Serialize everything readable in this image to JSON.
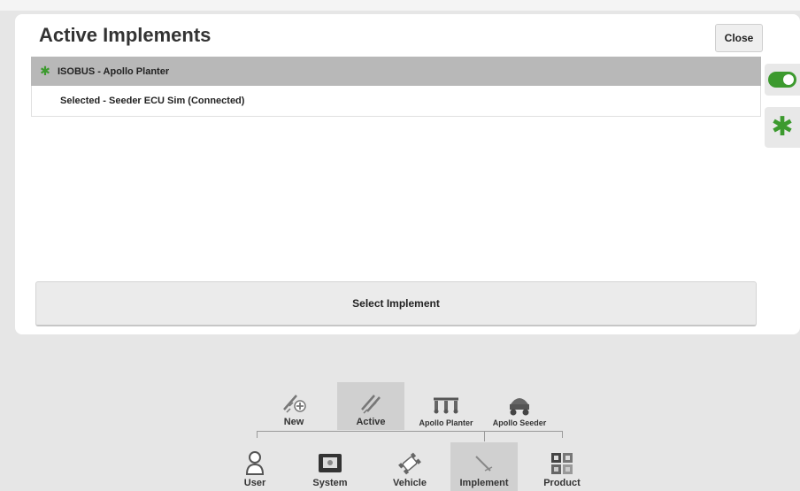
{
  "page": {
    "title": "Active Implements",
    "close_label": "Close"
  },
  "implement_list": {
    "header_label": "ISOBUS - Apollo Planter",
    "sub_label": "Selected - Seeder ECU Sim (Connected)"
  },
  "select_button_label": "Select Implement",
  "sub_nav": {
    "items": [
      {
        "label": "New",
        "icon": "new-implement-icon",
        "active": false
      },
      {
        "label": "Active",
        "icon": "active-implement-icon",
        "active": true
      },
      {
        "label": "Apollo Planter",
        "icon": "planter-icon",
        "active": false
      },
      {
        "label": "Apollo Seeder",
        "icon": "seeder-icon",
        "active": false
      }
    ]
  },
  "main_nav": {
    "items": [
      {
        "label": "User",
        "icon": "user-icon",
        "active": false
      },
      {
        "label": "System",
        "icon": "system-icon",
        "active": false
      },
      {
        "label": "Vehicle",
        "icon": "vehicle-icon",
        "active": false
      },
      {
        "label": "Implement",
        "icon": "implement-icon",
        "active": true
      },
      {
        "label": "Product",
        "icon": "product-icon",
        "active": false
      }
    ]
  },
  "colors": {
    "accent_green": "#3c9a2e",
    "list_header_bg": "#b8b8b8",
    "background": "#e6e6e6",
    "active_nav_bg": "#d0d0d0"
  }
}
